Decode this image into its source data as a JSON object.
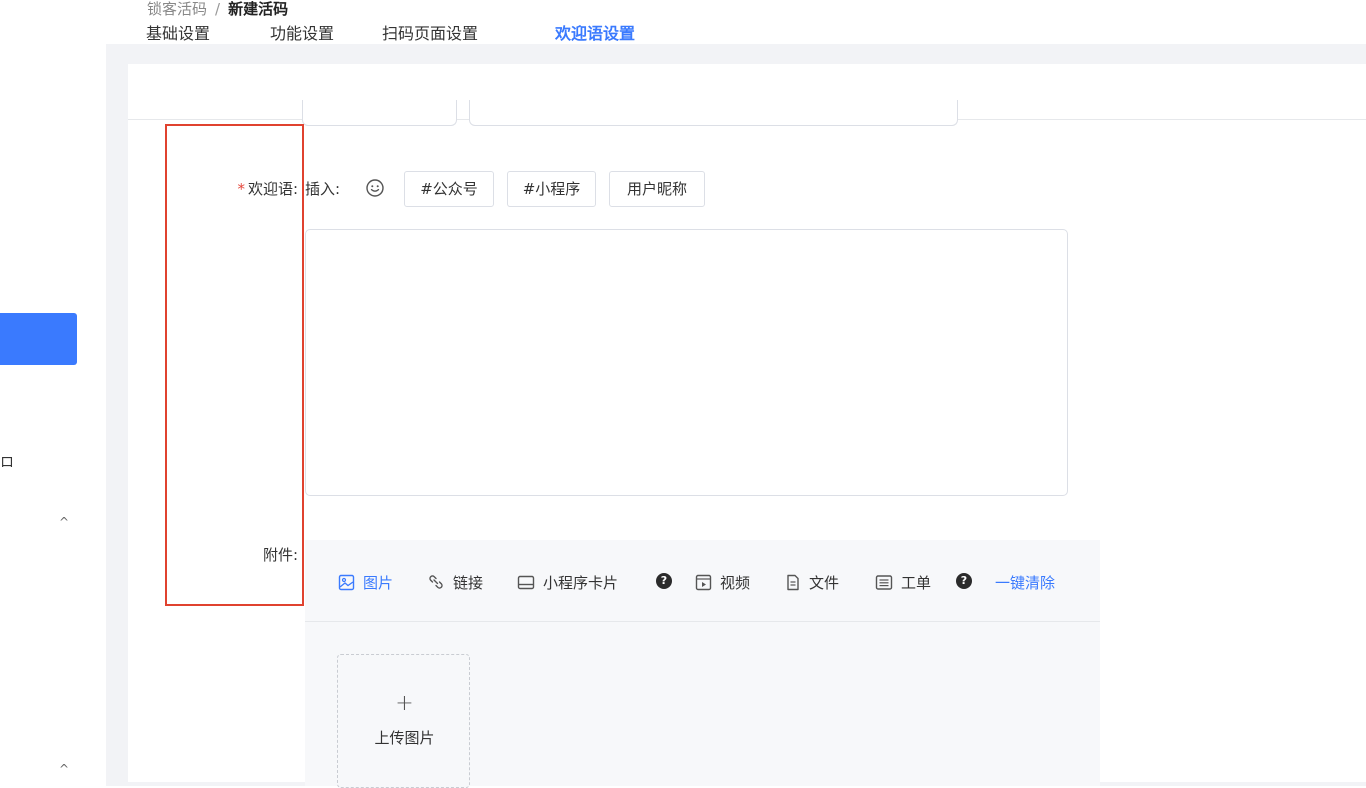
{
  "breadcrumb": {
    "parent": "锁客活码",
    "separator": "/",
    "current": "新建活码"
  },
  "sidebar": {
    "fragment_text": "ロ",
    "chevron_1": "^",
    "chevron_2": "^"
  },
  "tabs": [
    {
      "label": "基础设置",
      "active": false
    },
    {
      "label": "功能设置",
      "active": false
    },
    {
      "label": "扫码页面设置",
      "active": false
    },
    {
      "label": "欢迎语设置",
      "active": true
    }
  ],
  "form": {
    "welcome_label": "欢迎语:",
    "required_mark": "*",
    "insert_label": "插入:",
    "insert_tags": [
      "#公众号",
      "#小程序",
      "用户昵称"
    ],
    "attachment_label": "附件:"
  },
  "attachments": {
    "tools": [
      {
        "label": "图片",
        "icon": "image-icon",
        "active": true
      },
      {
        "label": "链接",
        "icon": "link-icon",
        "active": false
      },
      {
        "label": "小程序卡片",
        "icon": "miniprogram-card-icon",
        "active": false,
        "help": true
      },
      {
        "label": "视频",
        "icon": "video-icon",
        "active": false
      },
      {
        "label": "文件",
        "icon": "file-icon",
        "active": false
      },
      {
        "label": "工单",
        "icon": "workorder-icon",
        "active": false,
        "help": true
      }
    ],
    "help_glyph": "?",
    "clear_all": "一键清除",
    "upload_plus": "+",
    "upload_label": "上传图片"
  },
  "colors": {
    "accent": "#3a7afe",
    "required": "#e5483d",
    "annotation": "#e0422f"
  }
}
